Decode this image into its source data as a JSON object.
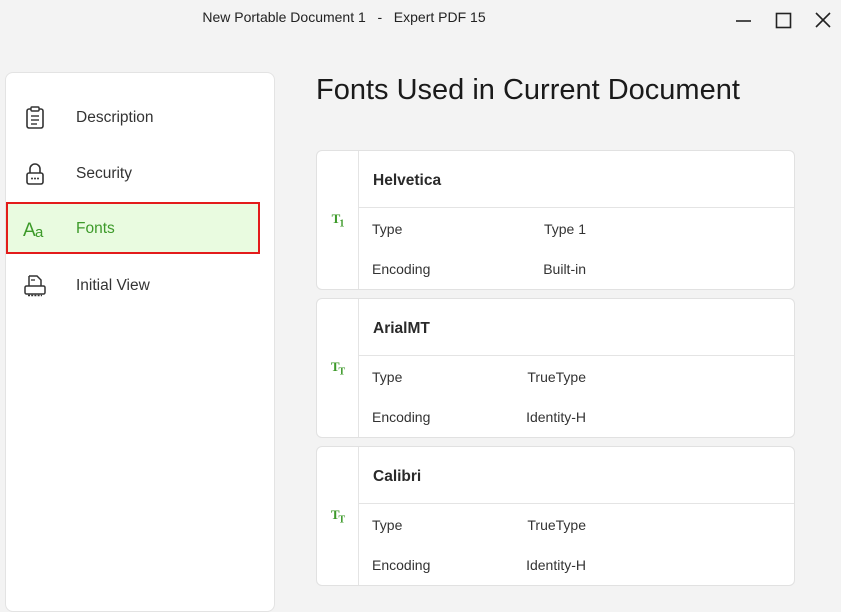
{
  "window": {
    "title": "New Portable Document 1   -   Expert PDF 15",
    "minimize_icon": "minimize-icon",
    "maximize_icon": "maximize-icon",
    "close_icon": "close-icon"
  },
  "sidebar": {
    "items": [
      {
        "label": "Description",
        "icon": "clipboard-icon",
        "active": false
      },
      {
        "label": "Security",
        "icon": "lock-icon",
        "active": false
      },
      {
        "label": "Fonts",
        "icon": "font-aa-icon",
        "active": true
      },
      {
        "label": "Initial View",
        "icon": "printer-view-icon",
        "active": false
      }
    ]
  },
  "main": {
    "heading": "Fonts Used in Current Document",
    "fonts": [
      {
        "name": "Helvetica",
        "icon": "type1-font-icon",
        "type_label": "Type",
        "type": "Type 1",
        "encoding_label": "Encoding",
        "encoding": "Built-in"
      },
      {
        "name": "ArialMT",
        "icon": "truetype-font-icon",
        "type_label": "Type",
        "type": "TrueType",
        "encoding_label": "Encoding",
        "encoding": "Identity-H"
      },
      {
        "name": "Calibri",
        "icon": "truetype-font-icon",
        "type_label": "Type",
        "type": "TrueType",
        "encoding_label": "Encoding",
        "encoding": "Identity-H"
      }
    ]
  },
  "colors": {
    "accent": "#3d9a2a",
    "active_bg": "#e9fbe0",
    "highlight_border": "#e31b1b"
  }
}
